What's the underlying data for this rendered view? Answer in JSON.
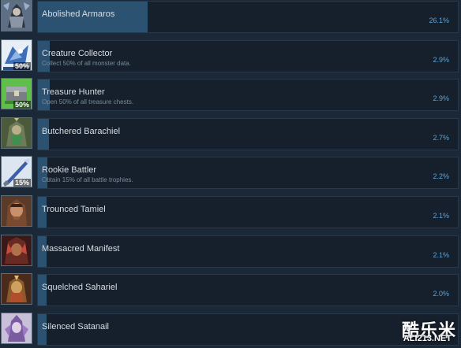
{
  "achievements": [
    {
      "title": "Abolished Armaros",
      "description": "",
      "percent": "26.1%",
      "fraction": 0.261,
      "icon": "armaros-icon",
      "badge": ""
    },
    {
      "title": "Creature Collector",
      "description": "Collect 50% of all monster data.",
      "percent": "2.9%",
      "fraction": 0.029,
      "icon": "creature-collector-icon",
      "badge": "50%"
    },
    {
      "title": "Treasure Hunter",
      "description": "Open 50% of all treasure chests.",
      "percent": "2.9%",
      "fraction": 0.029,
      "icon": "treasure-hunter-icon",
      "badge": "50%"
    },
    {
      "title": "Butchered Barachiel",
      "description": "",
      "percent": "2.7%",
      "fraction": 0.027,
      "icon": "barachiel-icon",
      "badge": ""
    },
    {
      "title": "Rookie Battler",
      "description": "Obtain 15% of all battle trophies.",
      "percent": "2.2%",
      "fraction": 0.022,
      "icon": "rookie-battler-icon",
      "badge": "15%"
    },
    {
      "title": "Trounced Tamiel",
      "description": "",
      "percent": "2.1%",
      "fraction": 0.021,
      "icon": "tamiel-icon",
      "badge": ""
    },
    {
      "title": "Massacred Manifest",
      "description": "",
      "percent": "2.1%",
      "fraction": 0.021,
      "icon": "manifest-icon",
      "badge": ""
    },
    {
      "title": "Squelched Sahariel",
      "description": "",
      "percent": "2.0%",
      "fraction": 0.02,
      "icon": "sahariel-icon",
      "badge": ""
    },
    {
      "title": "Silenced Satanail",
      "description": "",
      "percent": "",
      "fraction": 0.02,
      "icon": "satanail-icon",
      "badge": ""
    }
  ],
  "colors": {
    "background": "#1b2838",
    "panel": "#16202d",
    "fill": "#2c5272",
    "percent_text": "#5fa3d3"
  },
  "watermark": {
    "cn": "酷乐米",
    "en": "ALI213.NET"
  }
}
